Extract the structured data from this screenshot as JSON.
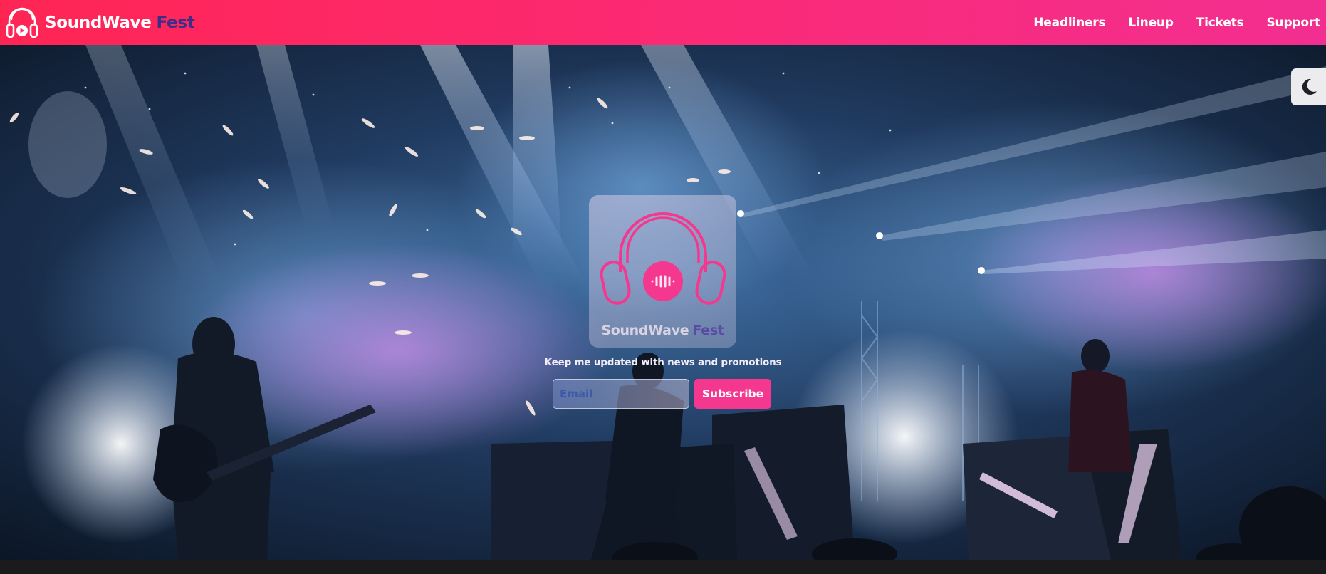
{
  "brand": {
    "name": "SoundWave",
    "suffix": "Fest"
  },
  "nav": {
    "items": [
      {
        "label": "Headliners"
      },
      {
        "label": "Lineup"
      },
      {
        "label": "Tickets"
      },
      {
        "label": "Support"
      }
    ]
  },
  "theme_toggle": {
    "icon": "moon-icon"
  },
  "hero": {
    "card": {
      "icon": "headphones-icon",
      "name": "SoundWave",
      "suffix": "Fest"
    },
    "newsletter": {
      "text": "Keep me updated with news and promotions",
      "email_placeholder": "Email",
      "subscribe_label": "Subscribe"
    }
  },
  "colors": {
    "nav_start": "#ff2553",
    "nav_end": "#f22f90",
    "accent_pink": "#f5388f",
    "brand_suffix": "#3a2f86"
  }
}
